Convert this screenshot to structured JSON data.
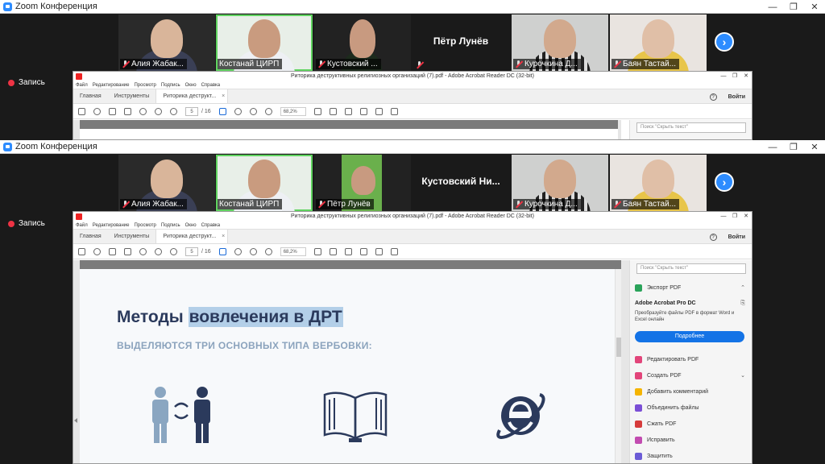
{
  "zoom": {
    "title": "Zoom Конференция",
    "record_label": "Запись",
    "controls": [
      "—",
      "❐",
      "✕"
    ],
    "strip1": {
      "participants": [
        {
          "name": "Алия Жабак..."
        },
        {
          "name": "Костанай ЦИРП"
        },
        {
          "name": "Кустовский ..."
        },
        {
          "name": "Пётр Лунёв"
        },
        {
          "name": "Курочкина Д..."
        },
        {
          "name": "Баян Тастай..."
        }
      ]
    },
    "strip2": {
      "participants": [
        {
          "name": "Алия Жабак..."
        },
        {
          "name": "Костанай ЦИРП"
        },
        {
          "name": "Пётр Лунёв"
        },
        {
          "name": "Кустовский  Ни..."
        },
        {
          "name": "Курочкина Д..."
        },
        {
          "name": "Баян Тастай..."
        }
      ]
    },
    "next_glyph": "›"
  },
  "acrobat": {
    "title": "Риторика деструктивных религиозных организаций (7).pdf - Adobe Acrobat Reader DC (32-bit)",
    "menu": [
      "Файл",
      "Редактирование",
      "Просмотр",
      "Подпись",
      "Окно",
      "Справка"
    ],
    "tabs": {
      "home": "Главная",
      "tools": "Инструменты",
      "doc": "Риторика деструкт...",
      "close": "×"
    },
    "help": "?",
    "signin": "Войти",
    "page_current": "5",
    "page_total": "/ 16",
    "zoom_level": "68,2%",
    "search_placeholder": "Поиск \"Скрыть текст\"",
    "slide": {
      "title_plain": "Методы ",
      "title_highlight": "вовлечения в ДРТ",
      "subtitle": "ВЫДЕЛЯЮТСЯ ТРИ ОСНОВНЫХ ТИПА ВЕРБОВКИ:"
    },
    "right_panel": {
      "export_label": "Экспорт PDF",
      "pro_title": "Adobe Acrobat Pro DC",
      "pro_desc": "Преобразуйте файлы PDF в формат Word и Excel онлайн",
      "more_button": "Подробнее",
      "tools": [
        {
          "label": "Редактировать PDF",
          "color": "#e2457a"
        },
        {
          "label": "Создать PDF",
          "color": "#e2457a"
        },
        {
          "label": "Добавить комментарий",
          "color": "#f5b400"
        },
        {
          "label": "Объединить файлы",
          "color": "#7b4fd6"
        },
        {
          "label": "Сжать PDF",
          "color": "#d63b3b"
        },
        {
          "label": "Исправить",
          "color": "#c24bb0"
        },
        {
          "label": "Защитить",
          "color": "#6b5bd6"
        }
      ]
    }
  }
}
